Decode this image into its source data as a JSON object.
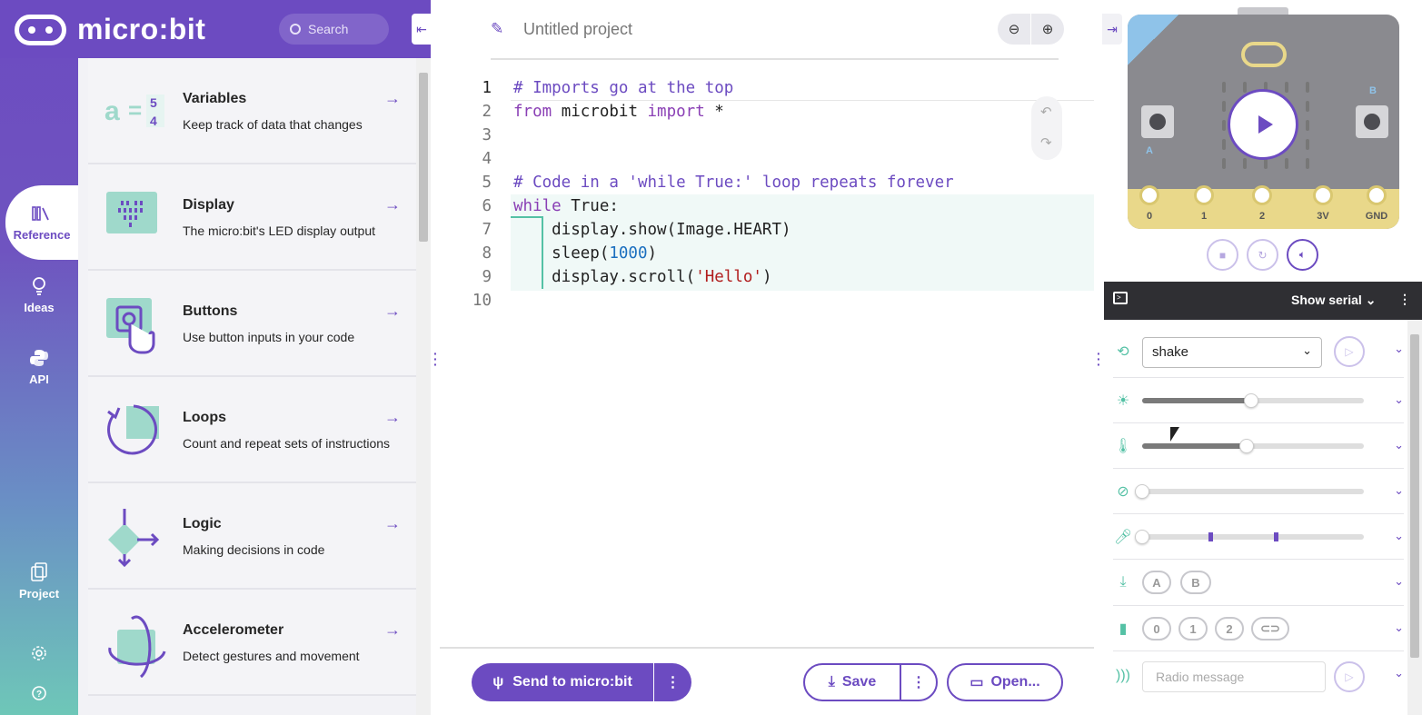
{
  "brand": {
    "name": "micro:bit"
  },
  "search": {
    "placeholder": "Search"
  },
  "rail": {
    "items": [
      {
        "label": "Reference",
        "icon": "library-icon"
      },
      {
        "label": "Ideas",
        "icon": "lightbulb-icon"
      },
      {
        "label": "API",
        "icon": "python-icon"
      },
      {
        "label": "Project",
        "icon": "files-icon"
      }
    ],
    "settings_icon": "gear-icon",
    "help_icon": "help-icon"
  },
  "reference": {
    "items": [
      {
        "title": "Variables",
        "desc": "Keep track of data that changes"
      },
      {
        "title": "Display",
        "desc": "The micro:bit's LED display output"
      },
      {
        "title": "Buttons",
        "desc": "Use button inputs in your code"
      },
      {
        "title": "Loops",
        "desc": "Count and repeat sets of instructions"
      },
      {
        "title": "Logic",
        "desc": "Making decisions in code"
      },
      {
        "title": "Accelerometer",
        "desc": "Detect gestures and movement"
      }
    ]
  },
  "editor": {
    "project_name": "Untitled project",
    "lines": [
      {
        "n": "1",
        "segments": [
          {
            "t": "# Imports go at the top",
            "c": "com"
          }
        ]
      },
      {
        "n": "2",
        "segments": [
          {
            "t": "from",
            "c": "kw"
          },
          {
            "t": " microbit ",
            "c": ""
          },
          {
            "t": "import",
            "c": "kw"
          },
          {
            "t": " *",
            "c": ""
          }
        ]
      },
      {
        "n": "3",
        "segments": []
      },
      {
        "n": "4",
        "segments": []
      },
      {
        "n": "5",
        "segments": [
          {
            "t": "# Code in a 'while True:' loop repeats forever",
            "c": "com"
          }
        ]
      },
      {
        "n": "6",
        "segments": [
          {
            "t": "while",
            "c": "kw"
          },
          {
            "t": " True:",
            "c": ""
          }
        ]
      },
      {
        "n": "7",
        "segments": [
          {
            "t": "    display.show(Image.HEART)",
            "c": ""
          }
        ]
      },
      {
        "n": "8",
        "segments": [
          {
            "t": "    sleep(",
            "c": ""
          },
          {
            "t": "1000",
            "c": "num"
          },
          {
            "t": ")",
            "c": ""
          }
        ]
      },
      {
        "n": "9",
        "segments": [
          {
            "t": "    display.scroll(",
            "c": ""
          },
          {
            "t": "'Hello'",
            "c": "str"
          },
          {
            "t": ")",
            "c": ""
          }
        ]
      },
      {
        "n": "10",
        "segments": []
      }
    ]
  },
  "actions": {
    "send_label": "Send to micro:bit",
    "save_label": "Save",
    "open_label": "Open..."
  },
  "simulator": {
    "pins": [
      "0",
      "1",
      "2",
      "3V",
      "GND"
    ],
    "button_a": "A",
    "button_b": "B"
  },
  "serial": {
    "label": "Show serial"
  },
  "sensors": {
    "gesture_value": "shake",
    "light_level": 0.49,
    "temperature_level": 0.47,
    "compass_level": 0.0,
    "sound_level": 0.0,
    "buttons": [
      "A",
      "B"
    ],
    "pins": [
      "0",
      "1",
      "2"
    ],
    "radio_placeholder": "Radio message"
  },
  "colors": {
    "accent": "#6c4bc1",
    "teal": "#54c1a5"
  }
}
